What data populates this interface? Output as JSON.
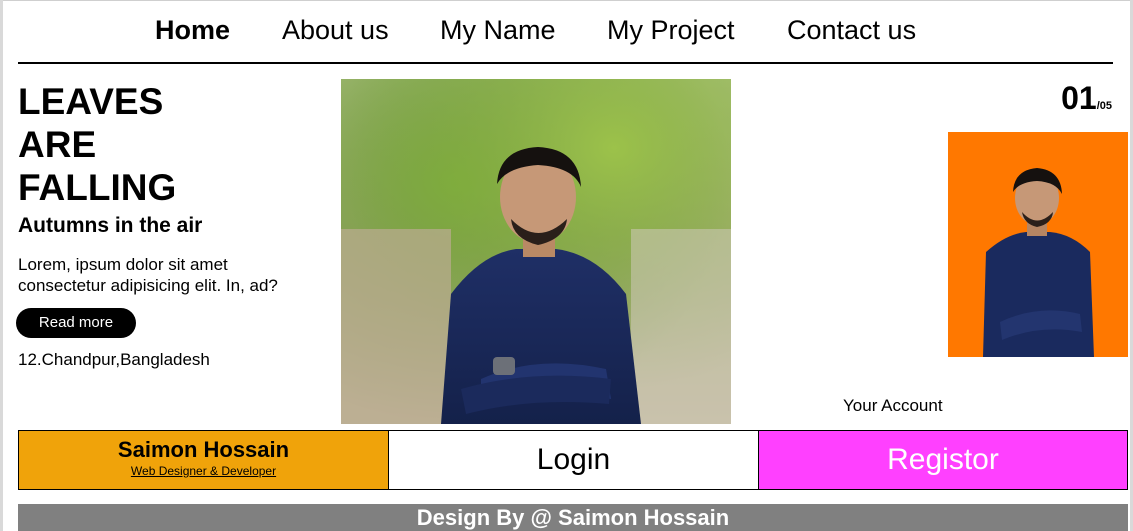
{
  "nav": {
    "items": [
      "Home",
      "About us",
      "My Name",
      "My Project",
      "Contact us"
    ]
  },
  "hero": {
    "title_lines": [
      "LEAVES",
      "ARE",
      "FALLING"
    ],
    "subtitle": "Autumns in the air",
    "text": "Lorem, ipsum dolor sit amet consectetur adipisicing elit. In, ad?",
    "button_label": "Read more",
    "address": "12.Chandpur,Bangladesh"
  },
  "images": {
    "main_photo": "portrait-photo-outdoor",
    "side_photo": "portrait-photo-orange-background"
  },
  "counter": {
    "current": "01",
    "total": "/05"
  },
  "account": {
    "label": "Your Account"
  },
  "boxes": {
    "name": "Saimon Hossain",
    "role": "Web Designer & Developer",
    "login": "Login",
    "register": "Registor"
  },
  "footer": {
    "text": "Design By @ Saimon Hossain"
  },
  "colors": {
    "name_box": "#f0a30a",
    "register_box": "#ff40ff",
    "side_photo_bg": "#ff7800",
    "footer_bg": "#808080"
  }
}
